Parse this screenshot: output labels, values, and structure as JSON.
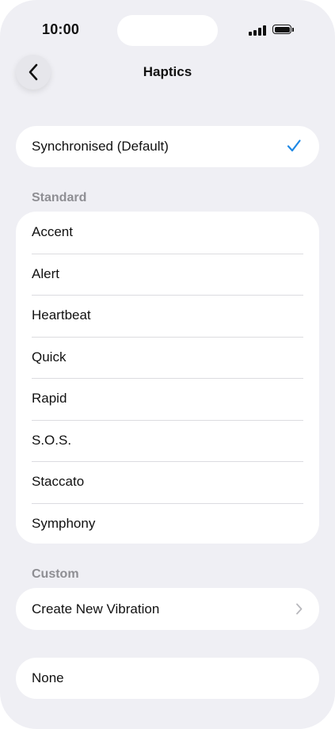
{
  "status_bar": {
    "time": "10:00"
  },
  "nav": {
    "title": "Haptics"
  },
  "default_option": {
    "label": "Synchronised (Default)",
    "selected": true
  },
  "standard_section": {
    "header": "Standard",
    "items": [
      {
        "label": "Accent"
      },
      {
        "label": "Alert"
      },
      {
        "label": "Heartbeat"
      },
      {
        "label": "Quick"
      },
      {
        "label": "Rapid"
      },
      {
        "label": "S.O.S."
      },
      {
        "label": "Staccato"
      },
      {
        "label": "Symphony"
      }
    ]
  },
  "custom_section": {
    "header": "Custom",
    "create_label": "Create New Vibration"
  },
  "none_option": {
    "label": "None"
  },
  "colors": {
    "accent": "#1e88e5",
    "background": "#efeff4",
    "secondary_text": "#8e8e93"
  },
  "icons": {
    "back": "chevron-left-icon",
    "selected": "checkmark-icon",
    "disclosure": "chevron-right-icon",
    "signal": "cellular-signal-icon",
    "battery": "battery-icon"
  }
}
